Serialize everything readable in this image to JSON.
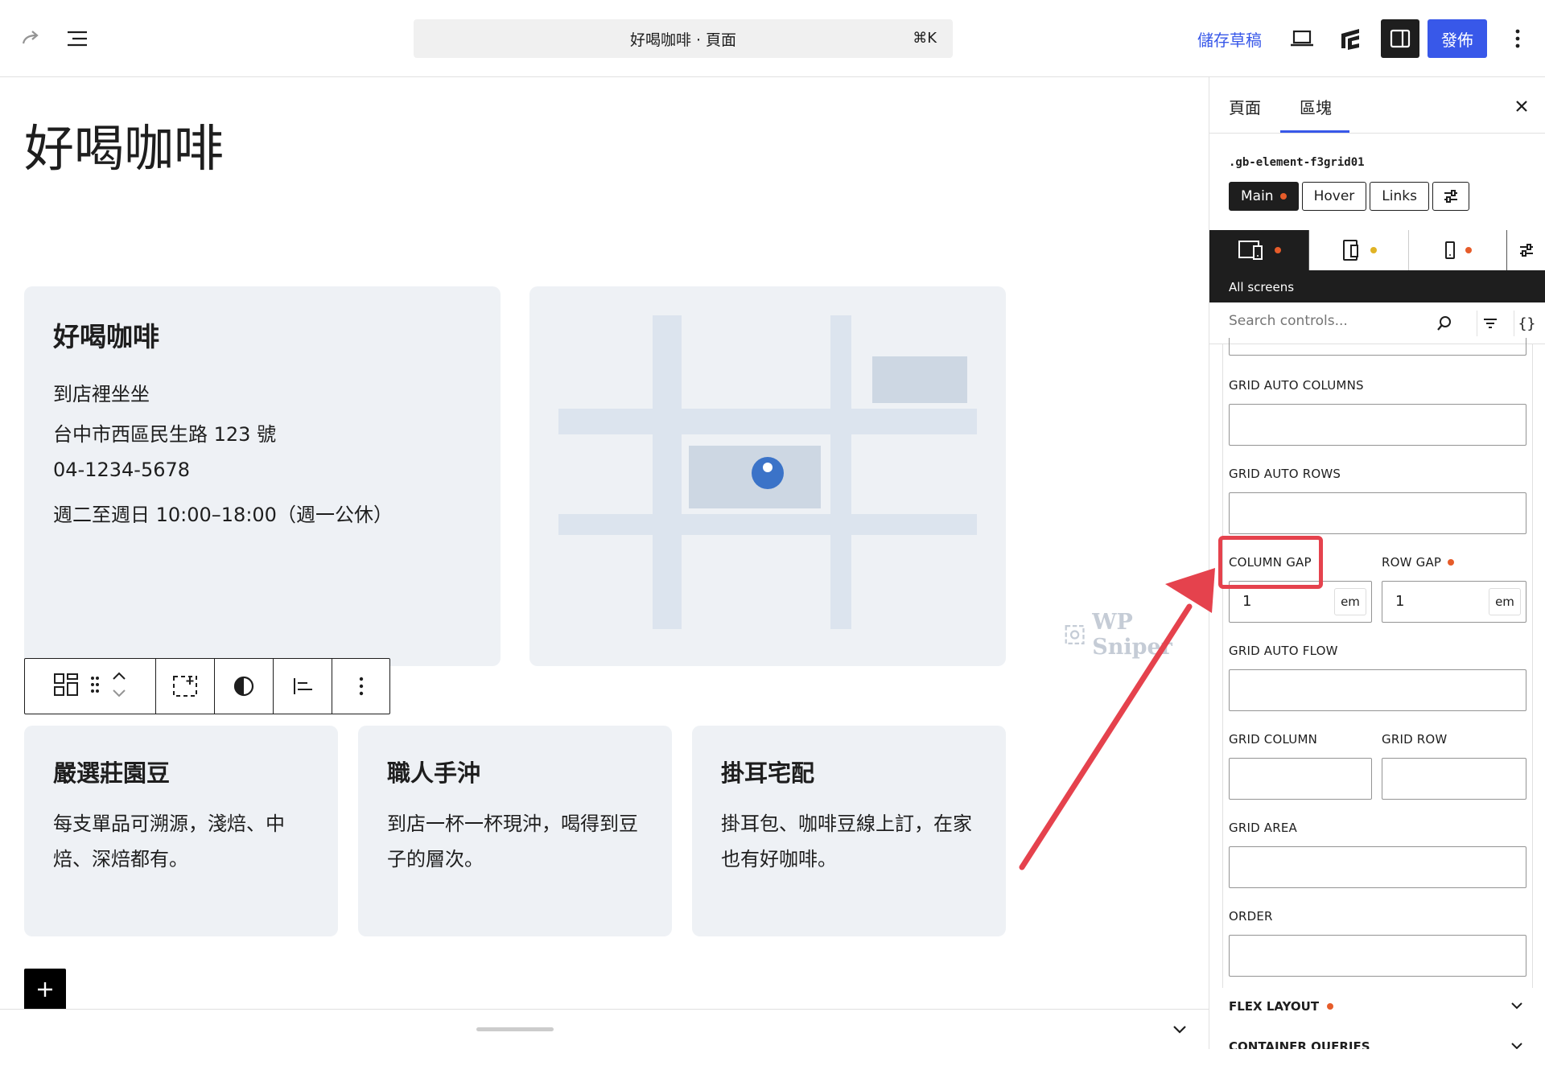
{
  "topbar": {
    "doc_title": "好喝咖啡 · 頁面",
    "shortcut": "⌘K",
    "save_draft": "儲存草稿",
    "publish": "發佈"
  },
  "canvas": {
    "page_title": "好喝咖啡",
    "info_card": {
      "title": "好喝咖啡",
      "lines": [
        "到店裡坐坐",
        "台中市西區民生路 123 號",
        "04-1234-5678",
        "週二至週日 10:00–18:00（週一公休）"
      ]
    },
    "features": [
      {
        "title": "嚴選莊園豆",
        "desc": "每支單品可溯源，淺焙、中焙、深焙都有。"
      },
      {
        "title": "職人手沖",
        "desc": "到店一杯一杯現沖，喝得到豆子的層次。"
      },
      {
        "title": "掛耳宅配",
        "desc": "掛耳包、咖啡豆線上訂，在家也有好咖啡。"
      }
    ],
    "watermark": "WP Sniper"
  },
  "sidebar": {
    "tabs": {
      "page": "頁面",
      "block": "區塊"
    },
    "selector": ".gb-element-f3grid01",
    "states": {
      "main": "Main",
      "hover": "Hover",
      "links": "Links"
    },
    "device_label": "All screens",
    "search_placeholder": "Search controls...",
    "code_icon": "{}",
    "controls": {
      "grid_auto_columns": "GRID AUTO COLUMNS",
      "grid_auto_rows": "GRID AUTO ROWS",
      "column_gap": "COLUMN GAP",
      "column_gap_value": "1",
      "column_gap_unit": "em",
      "row_gap": "ROW GAP",
      "row_gap_value": "1",
      "row_gap_unit": "em",
      "grid_auto_flow": "GRID AUTO FLOW",
      "grid_column": "GRID COLUMN",
      "grid_row": "GRID ROW",
      "grid_area": "GRID AREA",
      "order": "ORDER"
    },
    "sections": {
      "flex_layout": "FLEX LAYOUT",
      "container_queries": "CONTAINER QUERIES"
    }
  },
  "colors": {
    "accent": "#3858e9",
    "dark": "#1e1e1e",
    "card_bg": "#eef1f5",
    "highlight": "#e5424d",
    "dot_orange": "#e65c2a",
    "dot_yellow": "#e0b325"
  }
}
